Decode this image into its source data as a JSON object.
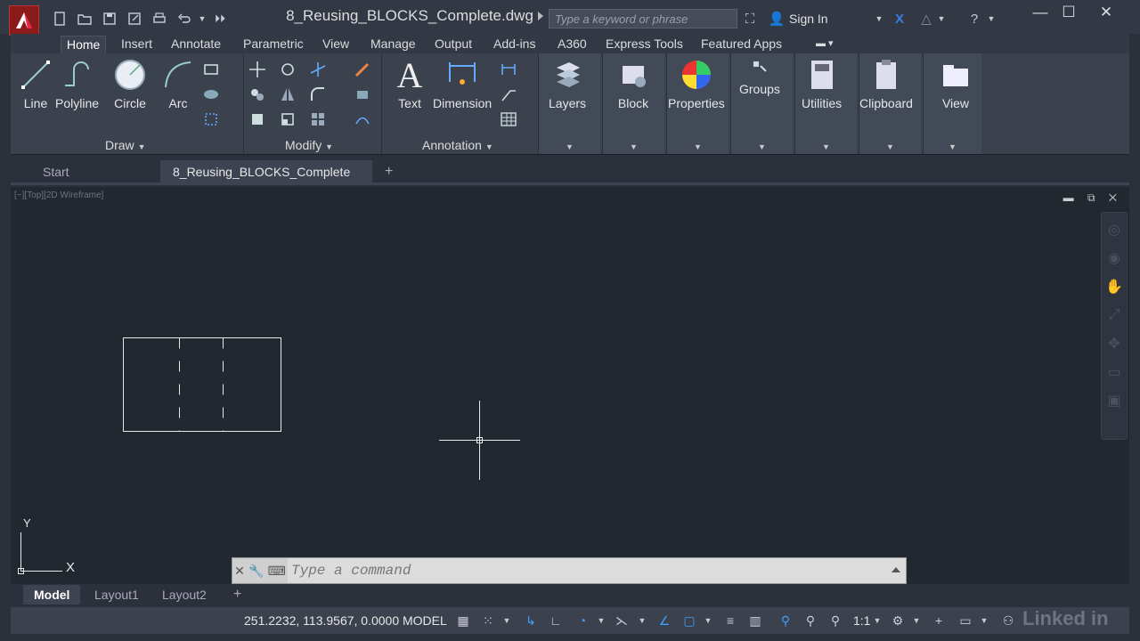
{
  "window": {
    "title": "8_Reusing_BLOCKS_Complete.dwg"
  },
  "search": {
    "placeholder": "Type a keyword or phrase"
  },
  "account": {
    "signin": "Sign In"
  },
  "ribbon_tabs": [
    "Home",
    "Insert",
    "Annotate",
    "Parametric",
    "View",
    "Manage",
    "Output",
    "Add-ins",
    "A360",
    "Express Tools",
    "Featured Apps"
  ],
  "ribbon": {
    "draw": {
      "line": "Line",
      "polyline": "Polyline",
      "circle": "Circle",
      "arc": "Arc",
      "panel": "Draw"
    },
    "modify": {
      "panel": "Modify"
    },
    "annotation": {
      "text": "Text",
      "dimension": "Dimension",
      "panel": "Annotation"
    },
    "layers": "Layers",
    "block": "Block",
    "properties": "Properties",
    "groups": "Groups",
    "utilities": "Utilities",
    "clipboard": "Clipboard",
    "view": "View"
  },
  "file_tabs": {
    "start": "Start",
    "active": "8_Reusing_BLOCKS_Complete",
    "add": "+"
  },
  "viewport": {
    "label": "[−][Top][2D Wireframe]"
  },
  "ucs": {
    "x": "X",
    "y": "Y"
  },
  "command": {
    "placeholder": "Type a command"
  },
  "layout_tabs": [
    "Model",
    "Layout1",
    "Layout2"
  ],
  "status": {
    "coords": "251.2232, 113.9567, 0.0000",
    "model": "MODEL",
    "scale": "1:1"
  },
  "watermark": "Linked in"
}
